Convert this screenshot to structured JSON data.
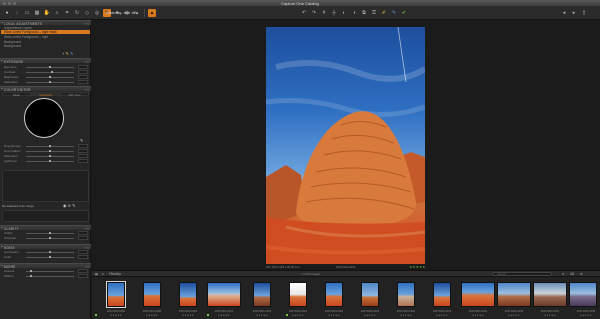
{
  "window": {
    "title": "Capture One Catalog"
  },
  "toolbar": {
    "document_tab": "Wave-day...rsyo .tiff",
    "left_tools": [
      "capture-icon",
      "import-icon",
      "folder-icon",
      "browse-icon",
      "pan-icon",
      "zoom-icon",
      "crop-icon",
      "rotate-icon",
      "keystone-icon",
      "spot-icon",
      "mask-icon",
      "pick-icon",
      "erase-icon",
      "levels-icon"
    ],
    "right_tools": [
      "undo-icon",
      "redo-icon",
      "grid-icon",
      "guides-icon",
      "exposure-icon",
      "proof-icon",
      "compare-icon",
      "lock-icon",
      "pencil-icon",
      "copy-icon",
      "apply-icon",
      "reset-icon"
    ],
    "right_edge": [
      "back-icon",
      "forward-icon",
      "sidebar-icon"
    ]
  },
  "leftpanel": {
    "layers_header": "LOCAL ADJUSTMENTS",
    "layers": [
      {
        "label": "Adjustments Layers",
        "selected": false
      },
      {
        "label": "Wave-toned Foreground – right mask",
        "selected": true
      },
      {
        "label": "Wave-toned Foreground – right",
        "selected": false
      },
      {
        "label": "Background",
        "selected": false
      },
      {
        "label": "Background",
        "selected": false
      }
    ],
    "exposure_header": "EXPOSURE",
    "exposure_sliders": [
      {
        "label": "Exposure",
        "value": 0.5
      },
      {
        "label": "Contrast",
        "value": 0.55
      },
      {
        "label": "Brightness",
        "value": 0.5
      },
      {
        "label": "Saturation",
        "value": 0.5
      }
    ],
    "color_editor_header": "COLOR EDITOR",
    "color_tabs": [
      "Basic",
      "Advanced",
      "Skin Tone"
    ],
    "color_sliders": [
      {
        "label": "Smoothness",
        "value": 0.5
      },
      {
        "label": "Hue rotation",
        "value": 0.5
      },
      {
        "label": "Saturation",
        "value": 0.5
      },
      {
        "label": "Lightness",
        "value": 0.5
      }
    ],
    "mask_note": "No selected color range",
    "clarity_header": "CLARITY",
    "clarity_sliders": [
      {
        "label": "Clarity",
        "value": 0.5
      },
      {
        "label": "Structure",
        "value": 0.5
      }
    ],
    "noise_header": "NOISE",
    "noise_sliders": [
      {
        "label": "Luminance",
        "value": 0.5
      },
      {
        "label": "Color",
        "value": 0.5
      }
    ],
    "moire_header": "MOIRÉ",
    "moire_rows": [
      {
        "label": "Amount",
        "value": 0.1
      },
      {
        "label": "Pattern",
        "value": 0.1
      }
    ]
  },
  "viewer": {
    "status_left": "ISO 200  1/125 s  f/8  35 mm",
    "status_mid": "20071004-0151",
    "status_right": "★ ★ ★ ★ ★"
  },
  "browser": {
    "label": "Filmstrip",
    "count": "1 of 23 images",
    "search_placeholder": "Search",
    "thumbs": [
      {
        "caption": "20071004-0082",
        "stars": "★★★★★",
        "selected": true,
        "tag": true
      },
      {
        "caption": "20071004-0088",
        "stars": "★★★★★",
        "selected": false,
        "tag": false
      },
      {
        "caption": "20071004-0094",
        "stars": "★★★★★",
        "selected": false,
        "tag": false
      },
      {
        "caption": "20071004-0101",
        "stars": "★★★★★",
        "selected": false,
        "tag": true
      },
      {
        "caption": "20071004-0104",
        "stars": "★★★★★",
        "selected": false,
        "tag": false
      },
      {
        "caption": "20071004-0110",
        "stars": "★★★★★",
        "selected": false,
        "tag": true
      },
      {
        "caption": "20071004-0116",
        "stars": "★★★★★",
        "selected": false,
        "tag": false
      },
      {
        "caption": "20071004-0120",
        "stars": "★★★★★",
        "selected": false,
        "tag": false
      },
      {
        "caption": "20071004-0126",
        "stars": "★★★★★",
        "selected": false,
        "tag": false
      },
      {
        "caption": "20071004-0133",
        "stars": "★★★★★",
        "selected": false,
        "tag": false
      },
      {
        "caption": "20071004-0141",
        "stars": "★★★★★",
        "selected": false,
        "tag": false
      },
      {
        "caption": "20071004-0145",
        "stars": "★★★★★",
        "selected": false,
        "tag": false
      },
      {
        "caption": "20071004-0151",
        "stars": "★★★★★",
        "selected": false,
        "tag": false
      },
      {
        "caption": "20071004-0158",
        "stars": "★★★★★",
        "selected": false,
        "tag": false
      }
    ]
  },
  "colors": {
    "accent": "#d97a1c",
    "panel": "#262626",
    "bg": "#1b1b1b",
    "ok": "#7ac943"
  }
}
